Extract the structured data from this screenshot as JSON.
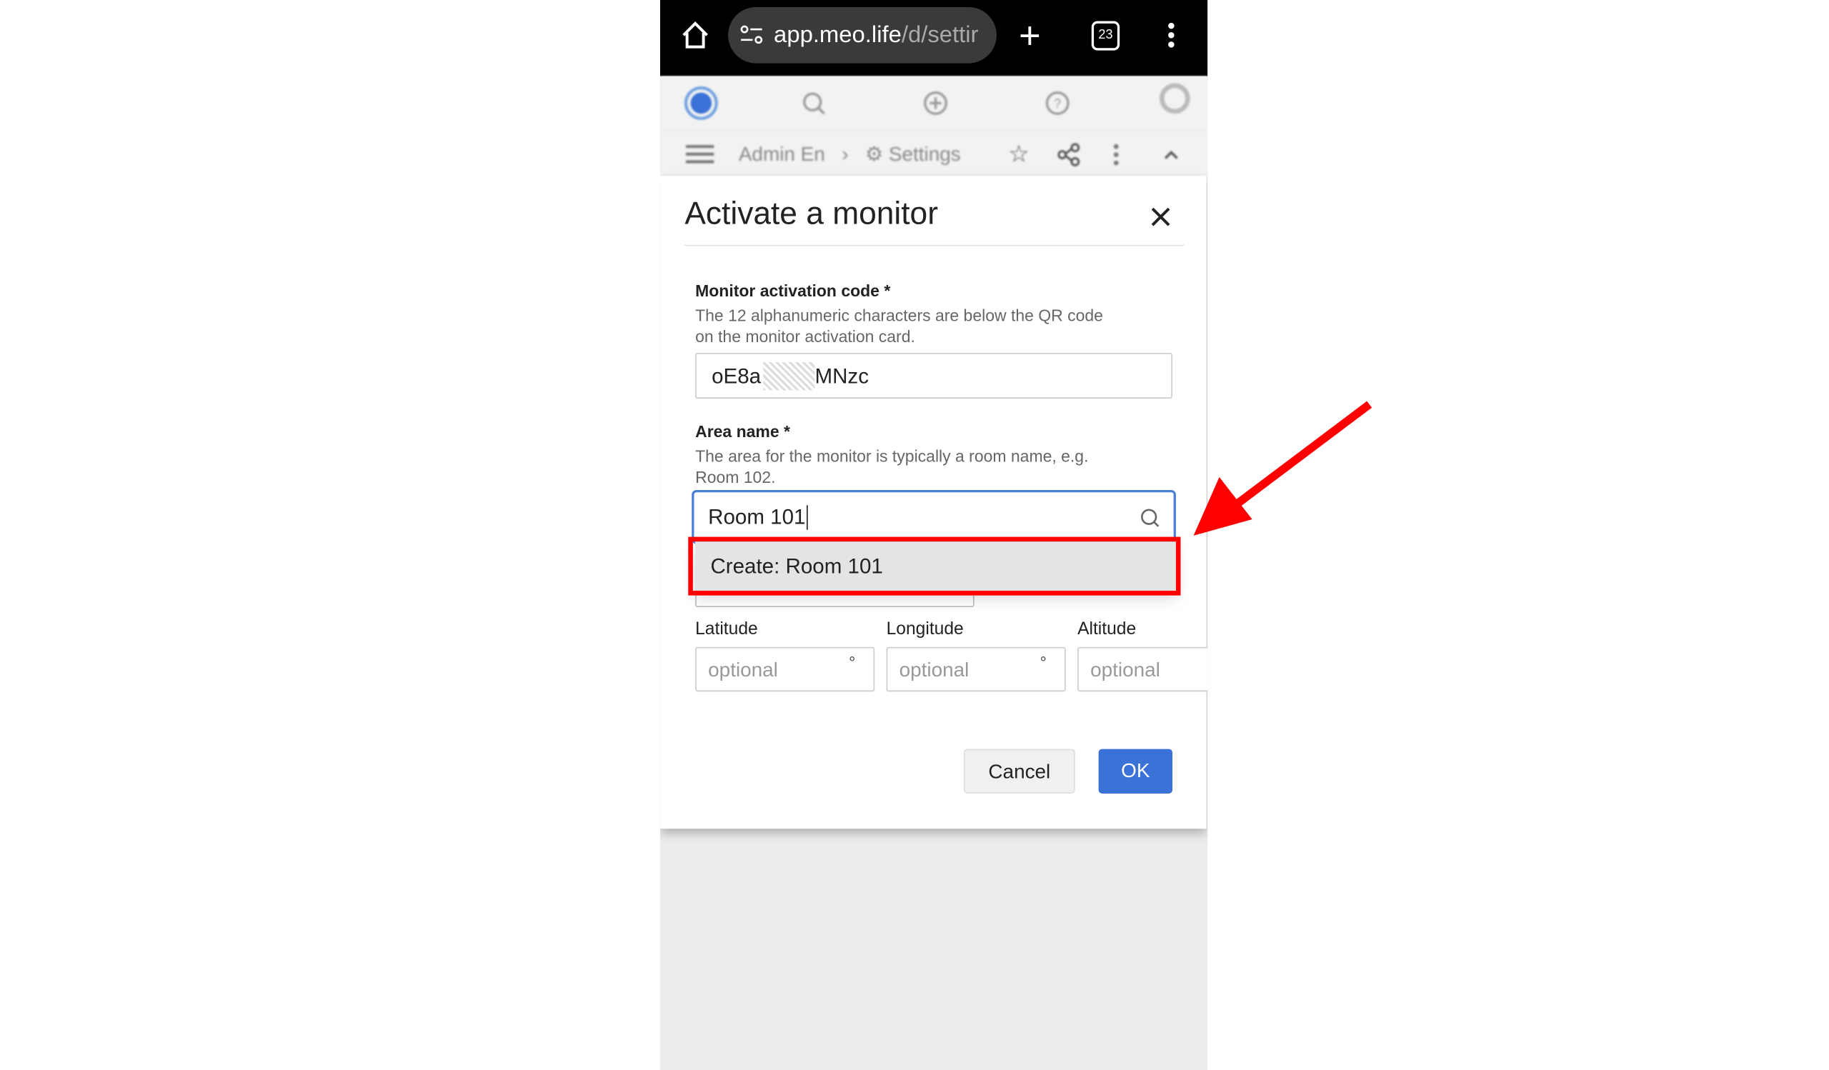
{
  "browser": {
    "url_host": "app.meo.life",
    "url_path": "/d/settir",
    "tab_count": "23"
  },
  "breadcrumb": {
    "item1": "Admin En",
    "separator": "›",
    "item2": "Settings"
  },
  "dialog": {
    "title": "Activate a monitor",
    "code": {
      "label": "Monitor activation code *",
      "help_line1": "The 12 alphanumeric characters are below the QR code",
      "help_line2": "on the monitor activation card.",
      "value_start": "oE8a",
      "value_end": "MNzc"
    },
    "area": {
      "label": "Area name *",
      "help_line1": "The area for the monitor is typically a room name, e.g.",
      "help_line2": "Room 102.",
      "value": "Room 101",
      "suggestion": "Create: Room 101"
    },
    "latitude": {
      "label": "Latitude",
      "placeholder": "optional",
      "unit": "°"
    },
    "longitude": {
      "label": "Longitude",
      "placeholder": "optional",
      "unit": "°"
    },
    "altitude": {
      "label": "Altitude",
      "placeholder": "optional"
    },
    "cancel": "Cancel",
    "ok": "OK"
  },
  "colors": {
    "accent": "#3a72d8",
    "highlight": "#ff0000"
  }
}
